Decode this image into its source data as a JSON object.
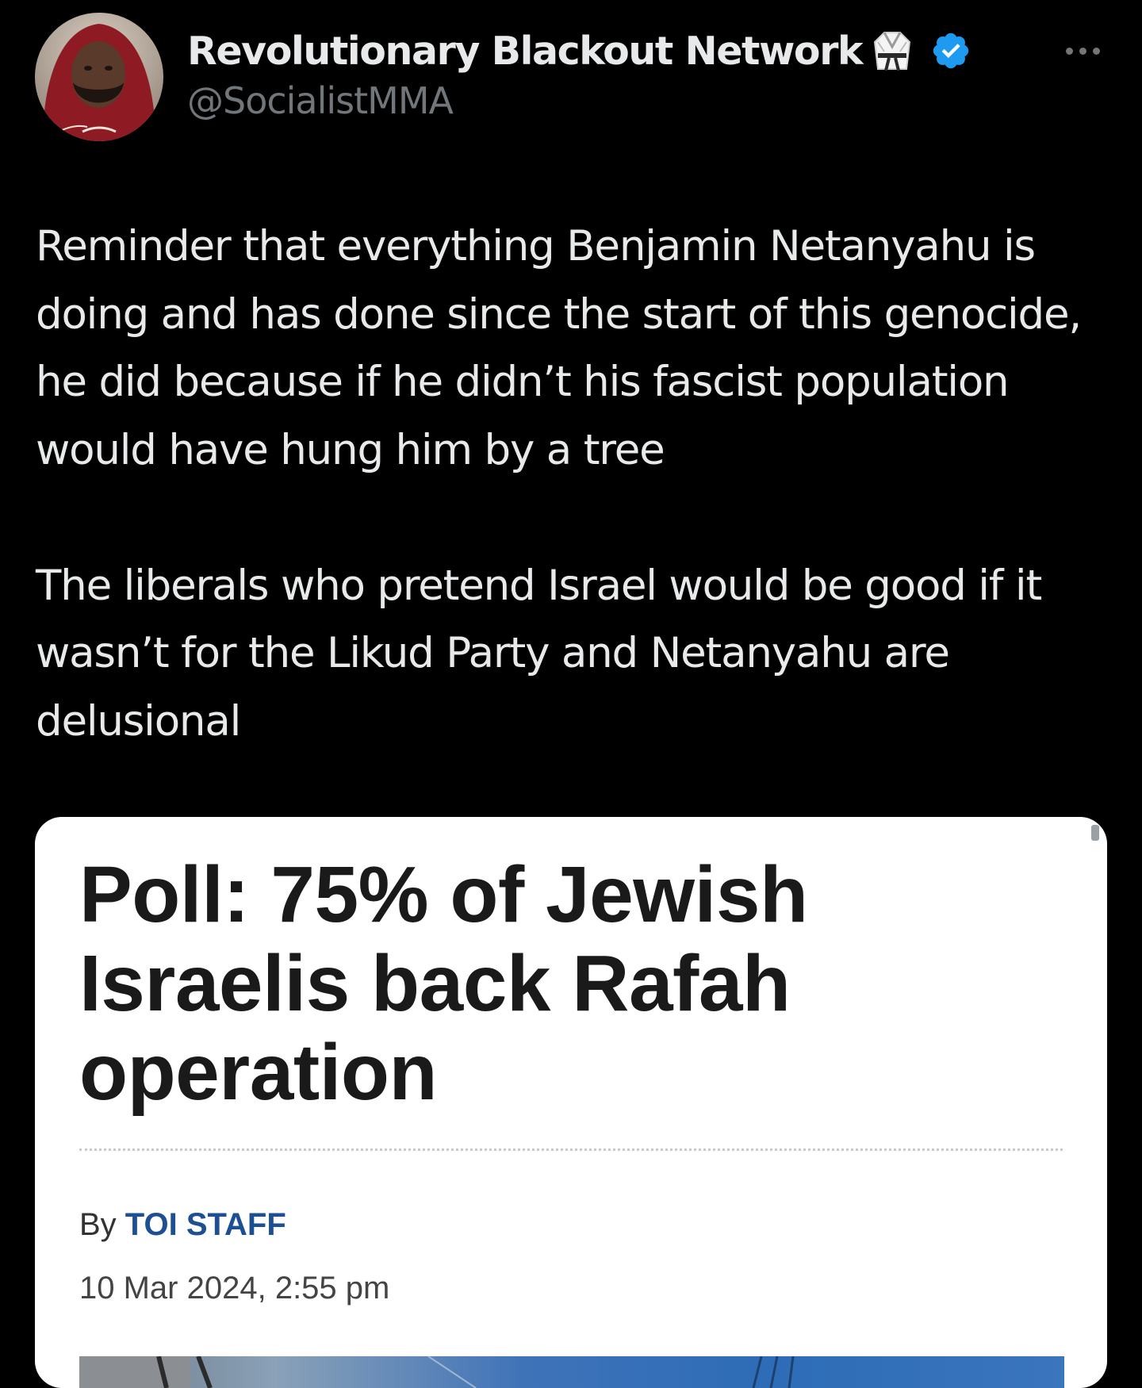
{
  "tweet": {
    "author": {
      "display_name": "Revolutionary Blackout Network",
      "handle": "@SocialistMMA",
      "name_emoji": "martial-arts-uniform",
      "verified": true
    },
    "text": {
      "paragraph_1": "Reminder that everything Benjamin Netanyahu is doing and has done since the start of this genocide, he did because if he didn’t his fascist population would have hung him by a tree",
      "paragraph_2": "The liberals who pretend Israel would be good if it wasn’t for the Likud Party and Netanyahu are delusional"
    },
    "article": {
      "headline": "Poll: 75% of Jewish Israelis back Rafah operation",
      "byline_prefix": "By ",
      "author": "TOI STAFF",
      "date": "10 Mar 2024, 2:55 pm"
    }
  },
  "icons": {
    "more": "more-horizontal-icon",
    "verified": "verified-badge-icon"
  },
  "colors": {
    "background": "#000000",
    "primary_text": "#e7e9ea",
    "secondary_text": "#71767b",
    "verified_blue": "#1d9bf0",
    "card_background": "#ffffff",
    "headline_text": "#1a1a1a",
    "author_link": "#1c4f93"
  }
}
